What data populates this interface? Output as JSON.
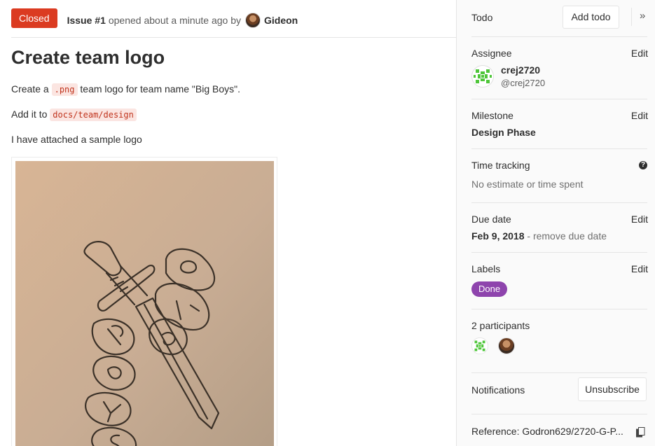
{
  "issue": {
    "status": "Closed",
    "number_label": "Issue #1",
    "opened_text": "opened about a minute ago by",
    "author": "Gideon",
    "title": "Create team logo",
    "desc1_before": "Create a",
    "desc1_code": ".png",
    "desc1_after": "team logo for team name \"Big Boys\".",
    "desc2_before": "Add it to",
    "desc2_code": "docs/team/design",
    "desc3": "I have attached a sample logo",
    "attachment_icon": "hand-drawn-sword-logo-image"
  },
  "sidebar": {
    "todo_label": "Todo",
    "add_todo_button": "Add todo",
    "collapse_icon": "»",
    "assignee_label": "Assignee",
    "assignee_edit": "Edit",
    "assignee_name": "crej2720",
    "assignee_handle": "@crej2720",
    "milestone_label": "Milestone",
    "milestone_edit": "Edit",
    "milestone_value": "Design Phase",
    "time_label": "Time tracking",
    "time_help": "?",
    "time_value": "No estimate or time spent",
    "due_label": "Due date",
    "due_edit": "Edit",
    "due_value": "Feb 9, 2018",
    "due_remove": "- remove due date",
    "labels_label": "Labels",
    "labels_edit": "Edit",
    "label_done": "Done",
    "participants_label": "2 participants",
    "notifications_label": "Notifications",
    "unsubscribe_button": "Unsubscribe",
    "reference_text": "Reference: Godron629/2720-G-P..."
  },
  "colors": {
    "closed": "#db3b21",
    "label_done": "#8e44ad",
    "identicon": "#4fc63a"
  }
}
